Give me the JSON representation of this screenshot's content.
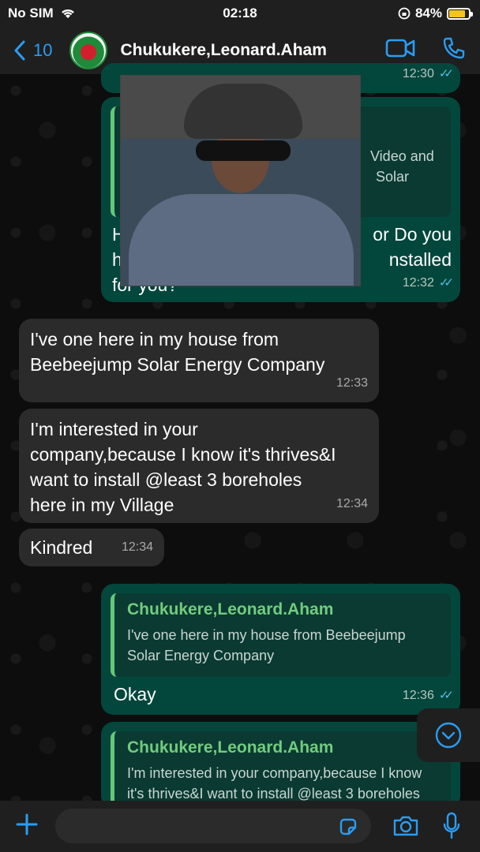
{
  "status_bar": {
    "carrier": "No SIM",
    "time": "02:18",
    "battery": "84%",
    "battery_level": 0.84
  },
  "header": {
    "back_count": "10",
    "contact_name": "Chukukere,Leonard.Aham"
  },
  "messages": [
    {
      "id": "m0",
      "time": "12:30"
    },
    {
      "id": "m1",
      "quote_tail_1": "Video and",
      "quote_tail_2": "Solar",
      "line1_start": "H",
      "line1_end": "or Do you",
      "line2_start": "h",
      "line2_end": "nstalled",
      "line3": "for you?",
      "time": "12:32"
    },
    {
      "id": "m2",
      "line1": "I've one here in my house from",
      "line2": "Beebeejump Solar Energy Company",
      "time": "12:33"
    },
    {
      "id": "m3",
      "line1": "I'm interested in your",
      "line2": "company,because I know it's thrives&I",
      "line3": "want to install @least 3 boreholes",
      "line4": "here in my Village",
      "time": "12:34"
    },
    {
      "id": "m4",
      "text": "Kindred",
      "time": "12:34"
    },
    {
      "id": "m5",
      "quote_name": "Chukukere,Leonard.Aham",
      "quote_line1": "I've one here in my house from Beebeejump",
      "quote_line2": "Solar Energy Company",
      "text": "Okay",
      "time": "12:36"
    },
    {
      "id": "m6",
      "quote_name": "Chukukere,Leonard.Aham",
      "quote_line1": "I'm interested in your company,because I know",
      "quote_line2": "it's thrives&I want to install @least 3 boreholes"
    }
  ]
}
